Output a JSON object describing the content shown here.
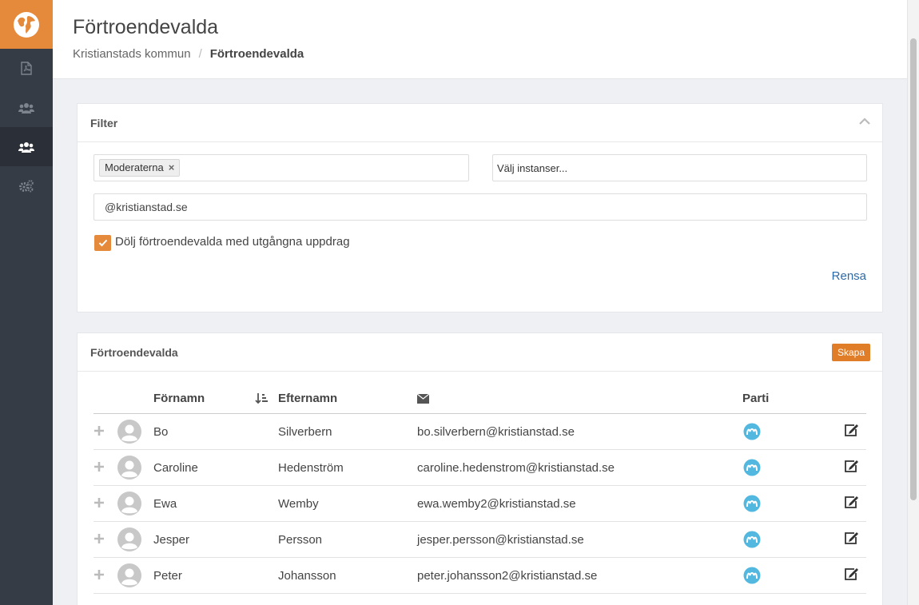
{
  "header": {
    "title": "Förtroendevalda",
    "breadcrumb": [
      "Kristianstads kommun",
      "/",
      "Förtroendevalda"
    ]
  },
  "sidebar": {
    "items": [
      {
        "icon": "pdf-icon",
        "active": false
      },
      {
        "icon": "group-icon",
        "active": false
      },
      {
        "icon": "group-icon",
        "active": true
      },
      {
        "icon": "cogs-icon",
        "active": false
      }
    ]
  },
  "filter": {
    "title": "Filter",
    "party_tag": "Moderaterna",
    "tag_remove": "×",
    "instances_placeholder": "Välj instanser...",
    "email_value": "@kristianstad.se",
    "hide_expired_label": "Dölj förtroendevalda med utgångna uppdrag",
    "hide_expired_checked": true,
    "clear_label": "Rensa"
  },
  "list": {
    "title": "Förtroendevalda",
    "create_label": "Skapa",
    "columns": {
      "firstname": "Förnamn",
      "lastname": "Efternamn",
      "email_icon": "envelope-icon",
      "party": "Parti"
    },
    "rows": [
      {
        "firstname": "Bo",
        "lastname": "Silverbern",
        "email": "bo.silverbern@kristianstad.se"
      },
      {
        "firstname": "Caroline",
        "lastname": "Hedenström",
        "email": "caroline.hedenstrom@kristianstad.se"
      },
      {
        "firstname": "Ewa",
        "lastname": "Wemby",
        "email": "ewa.wemby2@kristianstad.se"
      },
      {
        "firstname": "Jesper",
        "lastname": "Persson",
        "email": "jesper.persson@kristianstad.se"
      },
      {
        "firstname": "Peter",
        "lastname": "Johansson",
        "email": "peter.johansson2@kristianstad.se"
      }
    ]
  },
  "colors": {
    "accent": "#e58a3b",
    "sidebar": "#363c45",
    "party_blue": "#52b8e0",
    "link": "#2d6aa8"
  }
}
